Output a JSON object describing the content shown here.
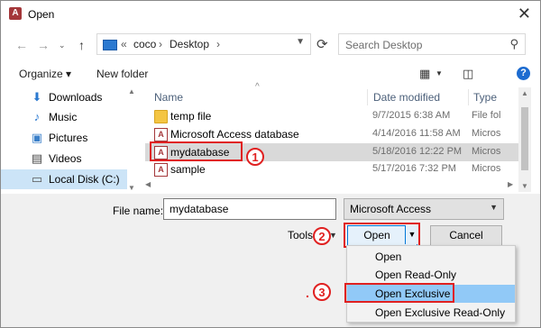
{
  "window": {
    "title": "Open",
    "app_icon_letter": "A"
  },
  "address": {
    "overflow": "«",
    "crumbs": [
      "coco",
      "Desktop"
    ],
    "sep": "›"
  },
  "search": {
    "placeholder": "Search Desktop"
  },
  "toolbar": {
    "organize": "Organize ▾",
    "new_folder": "New folder"
  },
  "nav_pane": {
    "items": [
      {
        "label": "Downloads",
        "icon": "download-arrow-icon",
        "glyph": "⬇",
        "color": "#2b79d0"
      },
      {
        "label": "Music",
        "icon": "music-note-icon",
        "glyph": "♪",
        "color": "#2b79d0"
      },
      {
        "label": "Pictures",
        "icon": "pictures-icon",
        "glyph": "▣",
        "color": "#3a7fc9"
      },
      {
        "label": "Videos",
        "icon": "film-icon",
        "glyph": "▤",
        "color": "#444444"
      },
      {
        "label": "Local Disk (C:)",
        "icon": "drive-icon",
        "glyph": "▭",
        "color": "#555555",
        "selected": true
      }
    ]
  },
  "file_list": {
    "columns": [
      "Name",
      "Date modified",
      "Type"
    ],
    "rows": [
      {
        "name": "temp file",
        "date": "9/7/2015 6:38 AM",
        "type": "File fol",
        "icon": "folder-icon"
      },
      {
        "name": "Microsoft Access database",
        "date": "4/14/2016 11:58 AM",
        "type": "Micros",
        "icon": "access-file-icon"
      },
      {
        "name": "mydatabase",
        "date": "5/18/2016 12:22 PM",
        "type": "Micros",
        "icon": "access-file-icon",
        "selected": true
      },
      {
        "name": "sample",
        "date": "5/17/2016 7:32 PM",
        "type": "Micros",
        "icon": "access-file-icon"
      }
    ]
  },
  "footer": {
    "file_name_label": "File name:",
    "file_name_value": "mydatabase",
    "file_type": "Microsoft Access",
    "tools": "Tools",
    "open": "Open",
    "cancel": "Cancel"
  },
  "open_menu": {
    "items": [
      {
        "label": "Open"
      },
      {
        "label": "Open Read-Only"
      },
      {
        "label": "Open Exclusive",
        "highlighted": true
      },
      {
        "label": "Open Exclusive Read-Only"
      }
    ]
  },
  "annotations": {
    "step1": "1",
    "step2": "2",
    "step3": "3",
    "dot": "."
  },
  "colors": {
    "accent": "#0078d7",
    "annotation_red": "#e02020",
    "menu_highlight": "#91c9f7"
  }
}
